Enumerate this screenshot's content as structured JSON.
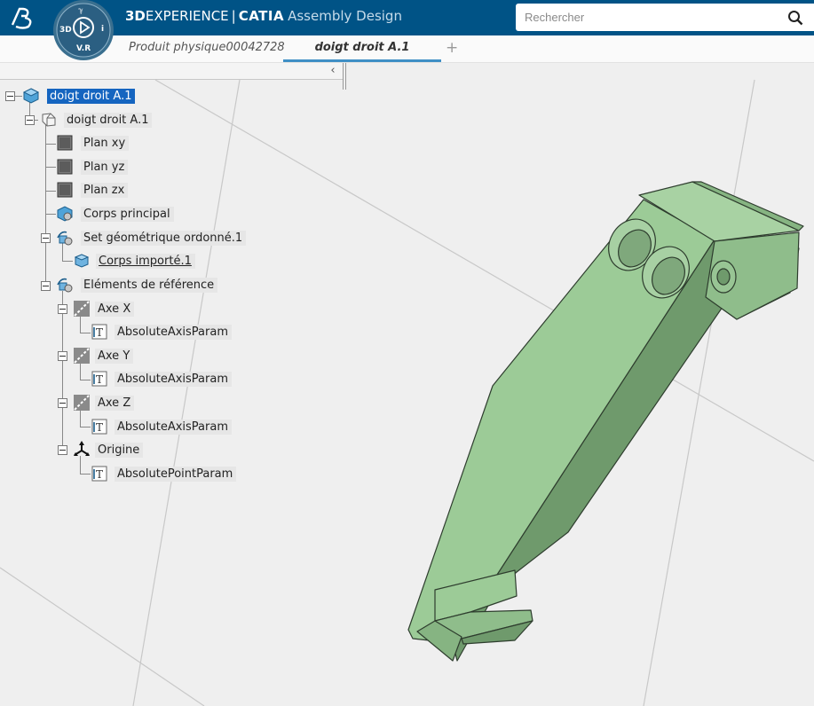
{
  "header": {
    "brand_prefix": "3D",
    "brand_experience": "EXPERIENCE",
    "brand_separator": "|",
    "brand_product": "CATIA",
    "brand_app": "Assembly Design",
    "compass_top": "3D",
    "compass_bottom": "V.R",
    "compass_right": "i",
    "search_placeholder": "Rechercher"
  },
  "tabs": [
    {
      "label": "Produit physique00042728",
      "active": false
    },
    {
      "label": "doigt droit A.1",
      "active": true
    }
  ],
  "tab_add": "+",
  "tree_collapse": "‹",
  "tree": [
    {
      "label": "doigt droit A.1",
      "icon": "product-icon",
      "selected": true
    },
    {
      "label": "doigt droit A.1",
      "icon": "part-icon"
    },
    {
      "label": "Plan xy",
      "icon": "plane-icon"
    },
    {
      "label": "Plan yz",
      "icon": "plane-icon"
    },
    {
      "label": "Plan zx",
      "icon": "plane-icon"
    },
    {
      "label": "Corps principal",
      "icon": "body-icon"
    },
    {
      "label": "Set géométrique ordonné.1",
      "icon": "geometric-set-icon"
    },
    {
      "label": "Corps importé.1",
      "icon": "imported-body-icon",
      "underline": true
    },
    {
      "label": "Eléments de référence",
      "icon": "reference-elements-icon"
    },
    {
      "label": "Axe X",
      "icon": "axis-icon"
    },
    {
      "label": "AbsoluteAxisParam",
      "icon": "parameter-icon"
    },
    {
      "label": "Axe Y",
      "icon": "axis-icon"
    },
    {
      "label": "AbsoluteAxisParam",
      "icon": "parameter-icon"
    },
    {
      "label": "Axe Z",
      "icon": "axis-icon"
    },
    {
      "label": "AbsoluteAxisParam",
      "icon": "parameter-icon"
    },
    {
      "label": "Origine",
      "icon": "origin-icon"
    },
    {
      "label": "AbsolutePointParam",
      "icon": "parameter-icon"
    }
  ],
  "colors": {
    "topbar": "#005386",
    "selection": "#1565c0",
    "part_light": "#9ccb97",
    "part_mid": "#86b482",
    "part_dark": "#6f9a6c",
    "part_edge": "#2e3d2e",
    "tab_underline": "#3f8fc5"
  }
}
